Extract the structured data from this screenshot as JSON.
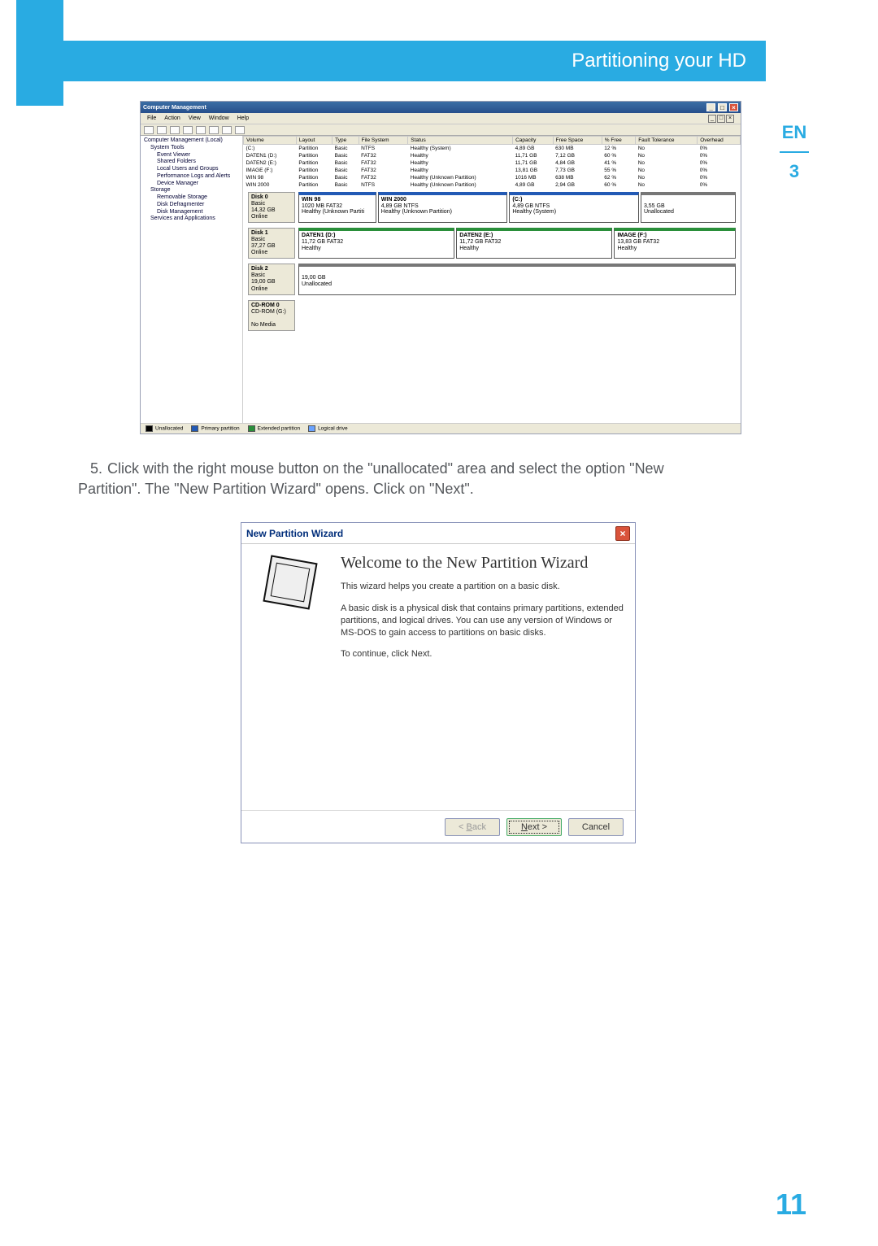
{
  "page": {
    "header_title": "Partitioning your HD",
    "lang_badge": "EN",
    "section_number": "3",
    "page_number": "11"
  },
  "step": {
    "number": "5.",
    "text": "Click with the right mouse button on the \"unallocated\" area and select the option \"New Partition\". The \"New Partition Wizard\" opens. Click on \"Next\"."
  },
  "shot1": {
    "window_title": "Computer Management",
    "menus": [
      "File",
      "Action",
      "View",
      "Window",
      "Help"
    ],
    "tree_root": "Computer Management (Local)",
    "tree": [
      "System Tools",
      "Event Viewer",
      "Shared Folders",
      "Local Users and Groups",
      "Performance Logs and Alerts",
      "Device Manager",
      "Storage",
      "Removable Storage",
      "Disk Defragmenter",
      "Disk Management",
      "Services and Applications"
    ],
    "columns": [
      "Volume",
      "Layout",
      "Type",
      "File System",
      "Status",
      "Capacity",
      "Free Space",
      "% Free",
      "Fault Tolerance",
      "Overhead"
    ],
    "partitions": [
      {
        "vol": "(C:)",
        "layout": "Partition",
        "type": "Basic",
        "fs": "NTFS",
        "status": "Healthy (System)",
        "cap": "4,89 GB",
        "free": "630 MB",
        "pct": "12 %",
        "fault": "No",
        "ovh": "0%"
      },
      {
        "vol": "DATEN1 (D:)",
        "layout": "Partition",
        "type": "Basic",
        "fs": "FAT32",
        "status": "Healthy",
        "cap": "11,71 GB",
        "free": "7,12 GB",
        "pct": "60 %",
        "fault": "No",
        "ovh": "0%"
      },
      {
        "vol": "DATEN2 (E:)",
        "layout": "Partition",
        "type": "Basic",
        "fs": "FAT32",
        "status": "Healthy",
        "cap": "11,71 GB",
        "free": "4,84 GB",
        "pct": "41 %",
        "fault": "No",
        "ovh": "0%"
      },
      {
        "vol": "IMAGE (F:)",
        "layout": "Partition",
        "type": "Basic",
        "fs": "FAT32",
        "status": "Healthy",
        "cap": "13,81 GB",
        "free": "7,73 GB",
        "pct": "55 %",
        "fault": "No",
        "ovh": "0%"
      },
      {
        "vol": "WIN 98",
        "layout": "Partition",
        "type": "Basic",
        "fs": "FAT32",
        "status": "Healthy (Unknown Partition)",
        "cap": "1016 MB",
        "free": "638 MB",
        "pct": "62 %",
        "fault": "No",
        "ovh": "0%"
      },
      {
        "vol": "WIN 2000",
        "layout": "Partition",
        "type": "Basic",
        "fs": "NTFS",
        "status": "Healthy (Unknown Partition)",
        "cap": "4,89 GB",
        "free": "2,94 GB",
        "pct": "60 %",
        "fault": "No",
        "ovh": "0%"
      }
    ],
    "disks": [
      {
        "name": "Disk 0",
        "kind": "Basic",
        "size": "14,32 GB",
        "state": "Online",
        "segments": [
          {
            "label": "WIN 98",
            "info": "1020 MB FAT32",
            "status": "Healthy (Unknown Partiti",
            "cls": "blue",
            "w": "18%"
          },
          {
            "label": "WIN 2000",
            "info": "4,89 GB NTFS",
            "status": "Healthy (Unknown Partition)",
            "cls": "blue",
            "w": "30%"
          },
          {
            "label": "(C:)",
            "info": "4,89 GB NTFS",
            "status": "Healthy (System)",
            "cls": "blue",
            "w": "30%"
          },
          {
            "label": "",
            "info": "3,55 GB",
            "status": "Unallocated",
            "cls": "hatch",
            "w": "22%"
          }
        ]
      },
      {
        "name": "Disk 1",
        "kind": "Basic",
        "size": "37,27 GB",
        "state": "Online",
        "segments": [
          {
            "label": "DATEN1 (D:)",
            "info": "11,72 GB FAT32",
            "status": "Healthy",
            "cls": "green",
            "w": "36%"
          },
          {
            "label": "DATEN2 (E:)",
            "info": "11,72 GB FAT32",
            "status": "Healthy",
            "cls": "green",
            "w": "36%"
          },
          {
            "label": "IMAGE (F:)",
            "info": "13,83 GB FAT32",
            "status": "Healthy",
            "cls": "green",
            "w": "28%"
          }
        ]
      },
      {
        "name": "Disk 2",
        "kind": "Basic",
        "size": "19,00 GB",
        "state": "Online",
        "segments": [
          {
            "label": "",
            "info": "19,00 GB",
            "status": "Unallocated",
            "cls": "hatch",
            "w": "100%"
          }
        ]
      },
      {
        "name": "CD-ROM 0",
        "kind": "CD-ROM (G:)",
        "size": "",
        "state": "No Media",
        "segments": []
      }
    ],
    "legend": [
      "Unallocated",
      "Primary partition",
      "Extended partition",
      "Logical drive"
    ]
  },
  "shot2": {
    "titlebar": "New Partition Wizard",
    "heading": "Welcome to the New Partition Wizard",
    "p1": "This wizard helps you create a partition on a basic disk.",
    "p2": "A basic disk is a physical disk that contains primary partitions, extended partitions, and logical drives. You can use any version of Windows or MS-DOS to gain access to partitions on basic disks.",
    "p3": "To continue, click Next.",
    "back": "< Back",
    "next": "Next >",
    "cancel": "Cancel"
  }
}
